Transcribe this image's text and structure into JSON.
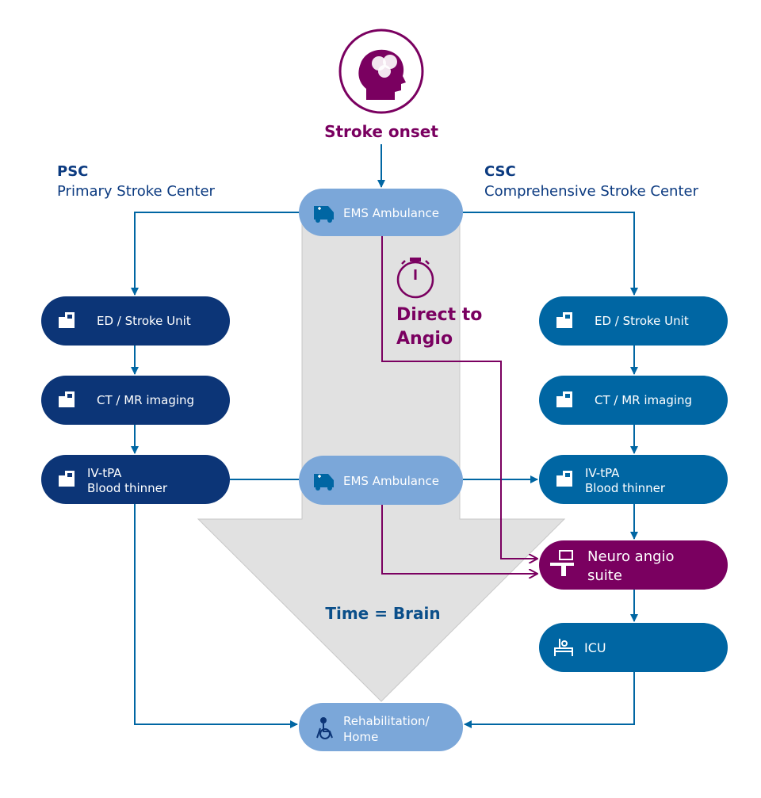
{
  "colors": {
    "psc_box": "#0c3577",
    "csc_box": "#0066a3",
    "ems_box": "#7ba7d9",
    "angio": "#7a0060",
    "funnel": "#e1e1e1",
    "heading_text": "#0b3a80",
    "time_text": "#0b4f8a"
  },
  "onset": {
    "label": "Stroke onset",
    "icon": "brain-head-icon"
  },
  "psc": {
    "abbr": "PSC",
    "name": "Primary Stroke Center"
  },
  "csc": {
    "abbr": "CSC",
    "name": "Comprehensive Stroke Center"
  },
  "ems_top": {
    "label": "EMS Ambulance",
    "icon": "ambulance-icon"
  },
  "ems_mid": {
    "label": "EMS Ambulance",
    "icon": "ambulance-icon"
  },
  "direct": {
    "line1": "Direct to",
    "line2": "Angio",
    "icon": "stopwatch-icon"
  },
  "psc_steps": [
    {
      "line1": "ED / Stroke Unit",
      "line2": "",
      "icon": "hospital-icon"
    },
    {
      "line1": "CT / MR imaging",
      "line2": "",
      "icon": "hospital-icon"
    },
    {
      "line1": "IV-tPA",
      "line2": "Blood thinner",
      "icon": "hospital-icon"
    }
  ],
  "csc_steps": [
    {
      "line1": "ED / Stroke Unit",
      "line2": "",
      "icon": "hospital-icon"
    },
    {
      "line1": "CT / MR imaging",
      "line2": "",
      "icon": "hospital-icon"
    },
    {
      "line1": "IV-tPA",
      "line2": "Blood thinner",
      "icon": "hospital-icon"
    }
  ],
  "angio_suite": {
    "line1": "Neuro angio",
    "line2": "suite",
    "icon": "angio-table-icon"
  },
  "icu": {
    "label": "ICU",
    "icon": "hospital-bed-icon"
  },
  "rehab": {
    "line1": "Rehabilitation/",
    "line2": "Home",
    "icon": "wheelchair-icon"
  },
  "funnel_label": "Time = Brain"
}
